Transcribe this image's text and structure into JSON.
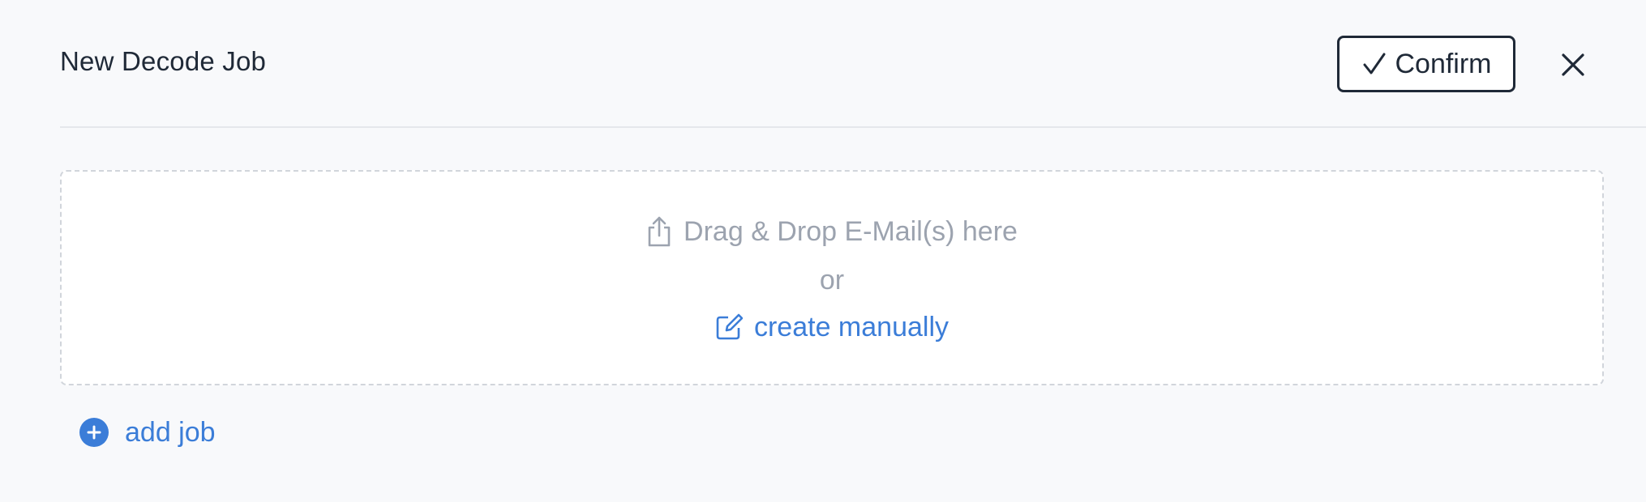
{
  "header": {
    "title": "New Decode Job",
    "confirm_label": "Confirm",
    "confirm_icon": "check-icon",
    "close_icon": "close-icon"
  },
  "dropzone": {
    "drag_label": "Drag & Drop E-Mail(s) here",
    "drag_icon": "upload-share-icon",
    "or_label": "or",
    "create_label": "create manually",
    "create_icon": "edit-square-icon"
  },
  "footer": {
    "add_job_label": "add job",
    "add_job_icon": "plus-circle-icon"
  },
  "colors": {
    "background": "#f8f9fb",
    "text_dark": "#1f2937",
    "muted": "#9ca3af",
    "accent": "#3b7dd8",
    "border": "#d1d5db"
  }
}
